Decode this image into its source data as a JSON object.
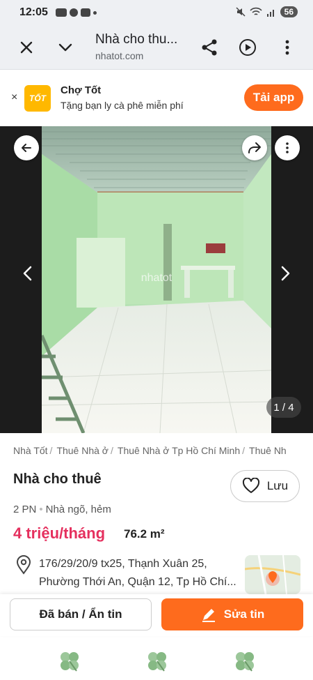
{
  "status_bar": {
    "time": "12:05",
    "battery": "56"
  },
  "browser": {
    "title": "Nhà cho thu...",
    "url": "nhatot.com"
  },
  "banner": {
    "logo_text": "TỐT",
    "app_name": "Chợ Tốt",
    "subtitle": "Tặng bạn ly cà phê miễn phí",
    "install_label": "Tải app"
  },
  "gallery": {
    "counter": "1 / 4",
    "watermark": "nhatot"
  },
  "breadcrumb": [
    "Nhà Tốt",
    "Thuê Nhà ở",
    "Thuê Nhà ở Tp Hồ Chí Minh",
    "Thuê Nh"
  ],
  "listing": {
    "title": "Nhà cho thuê",
    "save_label": "Lưu",
    "bedrooms": "2 PN",
    "house_type": "Nhà ngõ, hẻm",
    "price": "4 triệu/tháng",
    "area": "76.2 m²",
    "address_line1": "176/29/20/9 tx25, Thạnh Xuân 25,",
    "address_line2": "Phường Thới An, Quận 12, Tp Hồ Chí..."
  },
  "actions": {
    "hide_label": "Đã bán / Ẩn tin",
    "edit_label": "Sửa tin"
  },
  "colors": {
    "accent": "#fe6b1d",
    "price": "#e5305e",
    "logo": "#ffb800"
  }
}
